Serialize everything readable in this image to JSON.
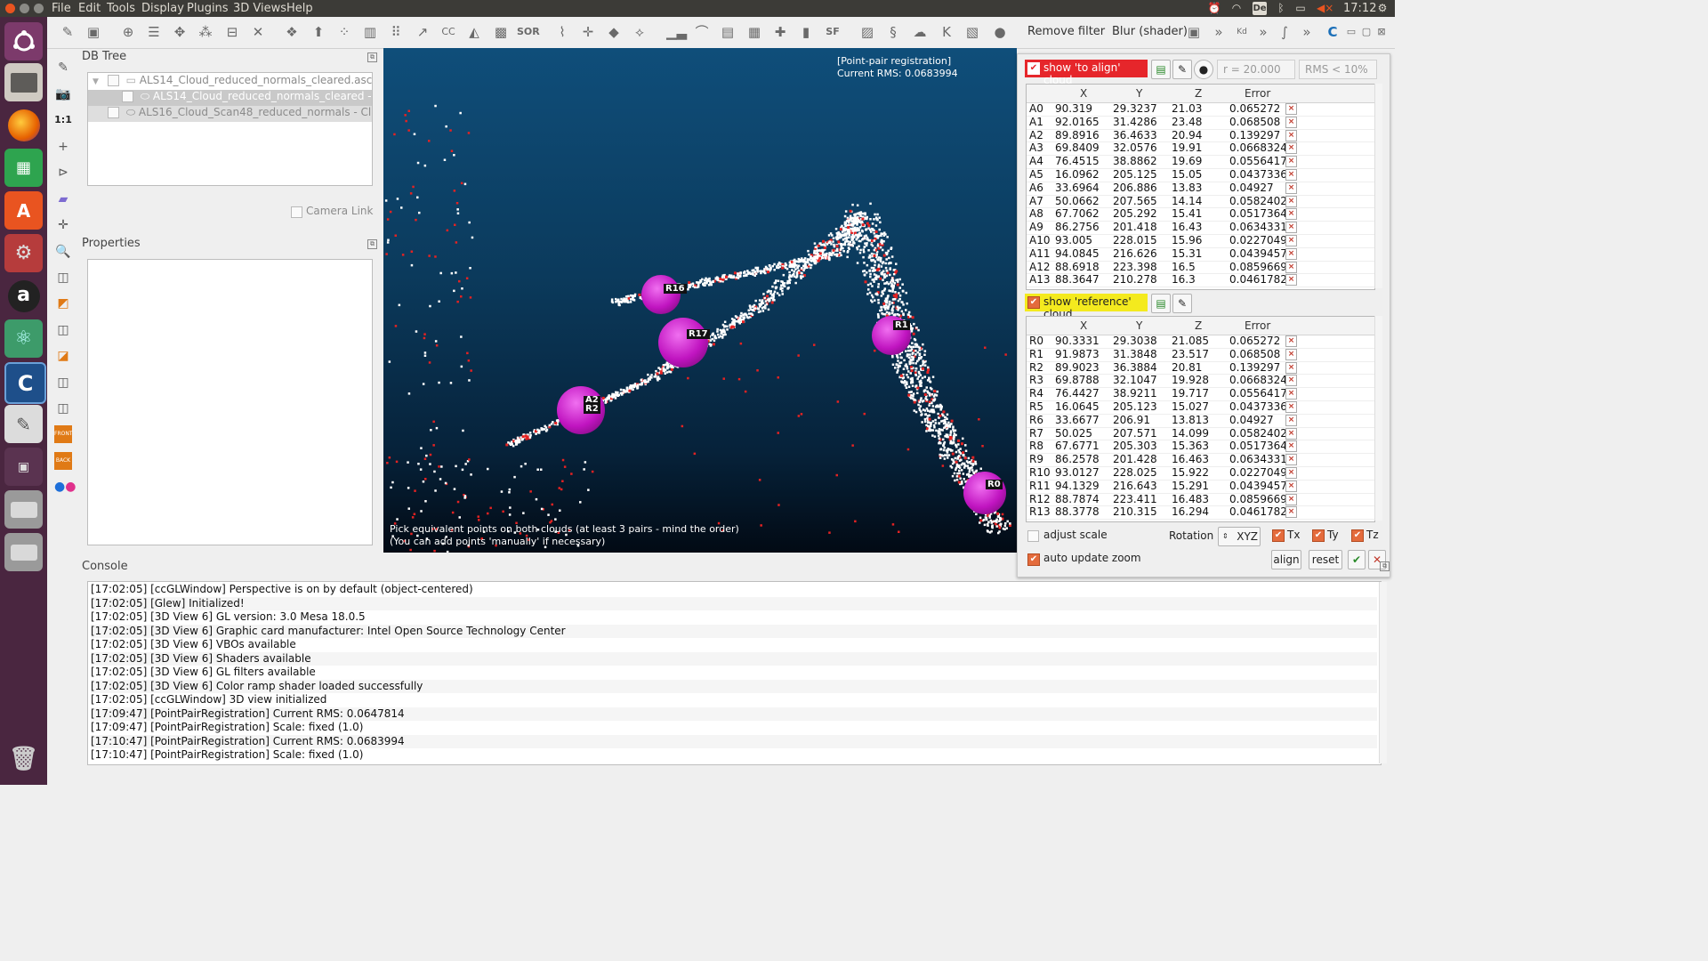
{
  "menubar": {
    "items": [
      "File",
      "Edit",
      "Tools",
      "Display",
      "Plugins",
      "3D Views",
      "Help"
    ],
    "clock": "17:12",
    "keyboard": "De"
  },
  "launcher": {
    "apps": [
      "ubuntu-dash-icon",
      "files-icon",
      "firefox-icon",
      "calc-icon",
      "software-center-icon",
      "settings-icon",
      "amazon-icon",
      "atom-icon",
      "cloudcompare-icon",
      "text-editor-icon",
      "workspace-icon",
      "drive-icon",
      "drive-icon",
      "trash-icon"
    ]
  },
  "toolbar": {
    "remove_filter": "Remove filter",
    "blur_shader": "Blur (shader)",
    "sor_label": "SOR",
    "sf_label": "SF",
    "kd_label": "Kd"
  },
  "left_tools": {
    "scale_label": "1:1",
    "front_label": "FRONT",
    "back_label": "BACK"
  },
  "db_tree": {
    "title": "DB Tree",
    "items": [
      {
        "label": "ALS14_Cloud_reduced_normals_cleared.asc..."
      },
      {
        "label": "ALS14_Cloud_reduced_normals_cleared -..."
      },
      {
        "label": "ALS16_Cloud_Scan48_reduced_normals - Cl..."
      }
    ],
    "camera_link": "Camera Link"
  },
  "properties": {
    "title": "Properties"
  },
  "view3d": {
    "overlay_title": "[Point-pair registration]",
    "overlay_rms": "Current RMS: 0.0683994",
    "hint_line1": "Pick equivalent points on both clouds (at least 3 pairs - mind the order)",
    "hint_line2": "(You can add points 'manually' if necessary)",
    "markers": [
      "R16",
      "R17",
      "A2",
      "R2",
      "R1",
      "R0"
    ]
  },
  "registration": {
    "to_align_label": "show 'to align' cloud",
    "radius": "r = 20.000",
    "rms_filter": "RMS < 10%",
    "reference_label": "show 'reference' cloud",
    "columns": [
      "X",
      "Y",
      "Z",
      "Error"
    ],
    "align_rows": [
      [
        "A0",
        "90.319",
        "29.3237",
        "21.03",
        "0.065272"
      ],
      [
        "A1",
        "92.0165",
        "31.4286",
        "23.48",
        "0.068508"
      ],
      [
        "A2",
        "89.8916",
        "36.4633",
        "20.94",
        "0.139297"
      ],
      [
        "A3",
        "69.8409",
        "32.0576",
        "19.91",
        "0.0668324"
      ],
      [
        "A4",
        "76.4515",
        "38.8862",
        "19.69",
        "0.0556417"
      ],
      [
        "A5",
        "16.0962",
        "205.125",
        "15.05",
        "0.0437336"
      ],
      [
        "A6",
        "33.6964",
        "206.886",
        "13.83",
        "0.04927"
      ],
      [
        "A7",
        "50.0662",
        "207.565",
        "14.14",
        "0.0582402"
      ],
      [
        "A8",
        "67.7062",
        "205.292",
        "15.41",
        "0.0517364"
      ],
      [
        "A9",
        "86.2756",
        "201.418",
        "16.43",
        "0.0634331"
      ],
      [
        "A10",
        "93.005",
        "228.015",
        "15.96",
        "0.0227049"
      ],
      [
        "A11",
        "94.0845",
        "216.626",
        "15.31",
        "0.0439457"
      ],
      [
        "A12",
        "88.6918",
        "223.398",
        "16.5",
        "0.0859669"
      ],
      [
        "A13",
        "88.3647",
        "210.278",
        "16.3",
        "0.0461782"
      ]
    ],
    "ref_rows": [
      [
        "R0",
        "90.3331",
        "29.3038",
        "21.085",
        "0.065272"
      ],
      [
        "R1",
        "91.9873",
        "31.3848",
        "23.517",
        "0.068508"
      ],
      [
        "R2",
        "89.9023",
        "36.3884",
        "20.81",
        "0.139297"
      ],
      [
        "R3",
        "69.8788",
        "32.1047",
        "19.928",
        "0.0668324"
      ],
      [
        "R4",
        "76.4427",
        "38.9211",
        "19.717",
        "0.0556417"
      ],
      [
        "R5",
        "16.0645",
        "205.123",
        "15.027",
        "0.0437336"
      ],
      [
        "R6",
        "33.6677",
        "206.91",
        "13.813",
        "0.04927"
      ],
      [
        "R7",
        "50.025",
        "207.571",
        "14.099",
        "0.0582402"
      ],
      [
        "R8",
        "67.6771",
        "205.303",
        "15.363",
        "0.0517364"
      ],
      [
        "R9",
        "86.2578",
        "201.428",
        "16.463",
        "0.0634331"
      ],
      [
        "R10",
        "93.0127",
        "228.025",
        "15.922",
        "0.0227049"
      ],
      [
        "R11",
        "94.1329",
        "216.643",
        "15.291",
        "0.0439457"
      ],
      [
        "R12",
        "88.7874",
        "223.411",
        "16.483",
        "0.0859669"
      ],
      [
        "R13",
        "88.3778",
        "210.315",
        "16.294",
        "0.0461782"
      ]
    ],
    "adjust_scale": "adjust scale",
    "rotation_label": "Rotation",
    "rotation_value": "XYZ",
    "tx": "Tx",
    "ty": "Ty",
    "tz": "Tz",
    "auto_update_zoom": "auto update zoom",
    "align_btn": "align",
    "reset_btn": "reset"
  },
  "console": {
    "title": "Console",
    "lines": [
      "[17:02:05] [ccGLWindow] Perspective is on by default (object-centered)",
      "[17:02:05] [Glew] Initialized!",
      "[17:02:05] [3D View 6] GL version: 3.0 Mesa 18.0.5",
      "[17:02:05] [3D View 6] Graphic card manufacturer: Intel Open Source Technology Center",
      "[17:02:05] [3D View 6] VBOs available",
      "[17:02:05] [3D View 6] Shaders available",
      "[17:02:05] [3D View 6] GL filters available",
      "[17:02:05] [3D View 6] Color ramp shader loaded successfully",
      "[17:02:05] [ccGLWindow] 3D view initialized",
      "[17:09:47] [PointPairRegistration] Current RMS: 0.0647814",
      "[17:09:47] [PointPairRegistration] Scale: fixed (1.0)",
      "[17:10:47] [PointPairRegistration] Current RMS: 0.0683994",
      "[17:10:47] [PointPairRegistration] Scale: fixed (1.0)"
    ]
  },
  "colors": {
    "launcher_bg": "#4a2640",
    "topbar_bg": "#3c3b37",
    "marker_magenta": "#d81fd8",
    "checkbox_orange": "#e46b3c",
    "to_align_bg": "#e6262b",
    "reference_bg": "#f4ea1e"
  }
}
